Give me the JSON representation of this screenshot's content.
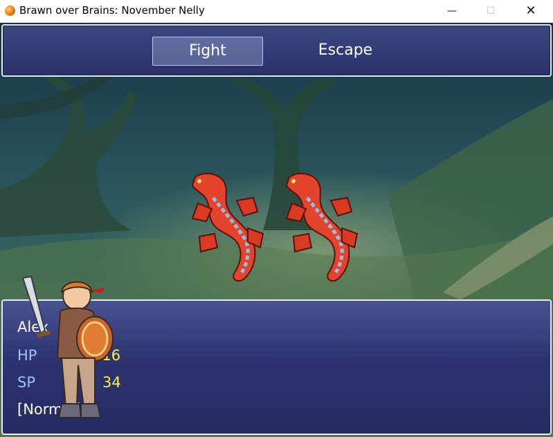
{
  "window": {
    "title": "Brawn over Brains: November Nelly",
    "icon": "orange-orb-icon",
    "minimize": "—",
    "maximize": "☐",
    "close": "✕"
  },
  "commands": [
    {
      "label": "Fight",
      "selected": true
    },
    {
      "label": "Escape",
      "selected": false
    }
  ],
  "enemies": [
    {
      "sprite": "red-lizard-sprite"
    },
    {
      "sprite": "red-lizard-sprite"
    }
  ],
  "actor": {
    "name": "Alex",
    "hp_label": "HP",
    "hp": "216",
    "sp_label": "SP",
    "sp": "34",
    "state": "[Normal]",
    "sprite": "swordsman-with-shield-sprite"
  },
  "colors": {
    "window_bg": "#2c3370",
    "window_border": "#e8ecf6",
    "stat_label": "#9fc1ff",
    "stat_value": "#ffef40",
    "enemy_red": "#e5442c"
  }
}
